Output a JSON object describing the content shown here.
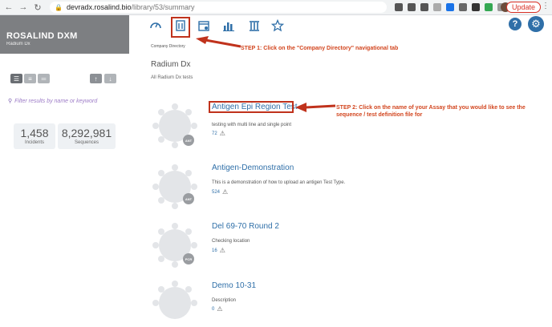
{
  "browser": {
    "url_host": "devradx.rosalind.bio",
    "url_path": "/library/53/summary",
    "update_label": "Update"
  },
  "brand": {
    "title": "ROSALIND DXM",
    "subtitle": "Radium Dx"
  },
  "filter": {
    "placeholder": "Filter results by name or keyword"
  },
  "stats": [
    {
      "value": "1,458",
      "label": "Incidents"
    },
    {
      "value": "8,292,981",
      "label": "Sequences"
    }
  ],
  "topnav": {
    "help_label": "?"
  },
  "annotations": {
    "step1": "STEP 1: Click on the \"Company Directory\" navigational tab",
    "step2": "STEP 2: Click on the name of your Assay that you would like to see the sequence / test definition file for"
  },
  "main": {
    "breadcrumb": "Company Directory",
    "title": "Radium Dx",
    "description": "All Radium Dx tests"
  },
  "assays": [
    {
      "name": "Antigen Epi Region Test",
      "description": "testing with multi line and single point",
      "count": "72",
      "badge": "ANT"
    },
    {
      "name": "Antigen-Demonstration",
      "description": "This is a demonstration of how to upload an antigen Test Type.",
      "count": "524",
      "badge": "ANT"
    },
    {
      "name": "Del 69-70 Round 2",
      "description": "Checking location",
      "count": "16",
      "badge": "PCR"
    },
    {
      "name": "Demo 10-31",
      "description": "Description",
      "count": "0",
      "badge": ""
    }
  ],
  "colors": {
    "accent": "#2f6fa8",
    "annotation": "#d2451e",
    "brand_bg": "#7d7f82"
  }
}
